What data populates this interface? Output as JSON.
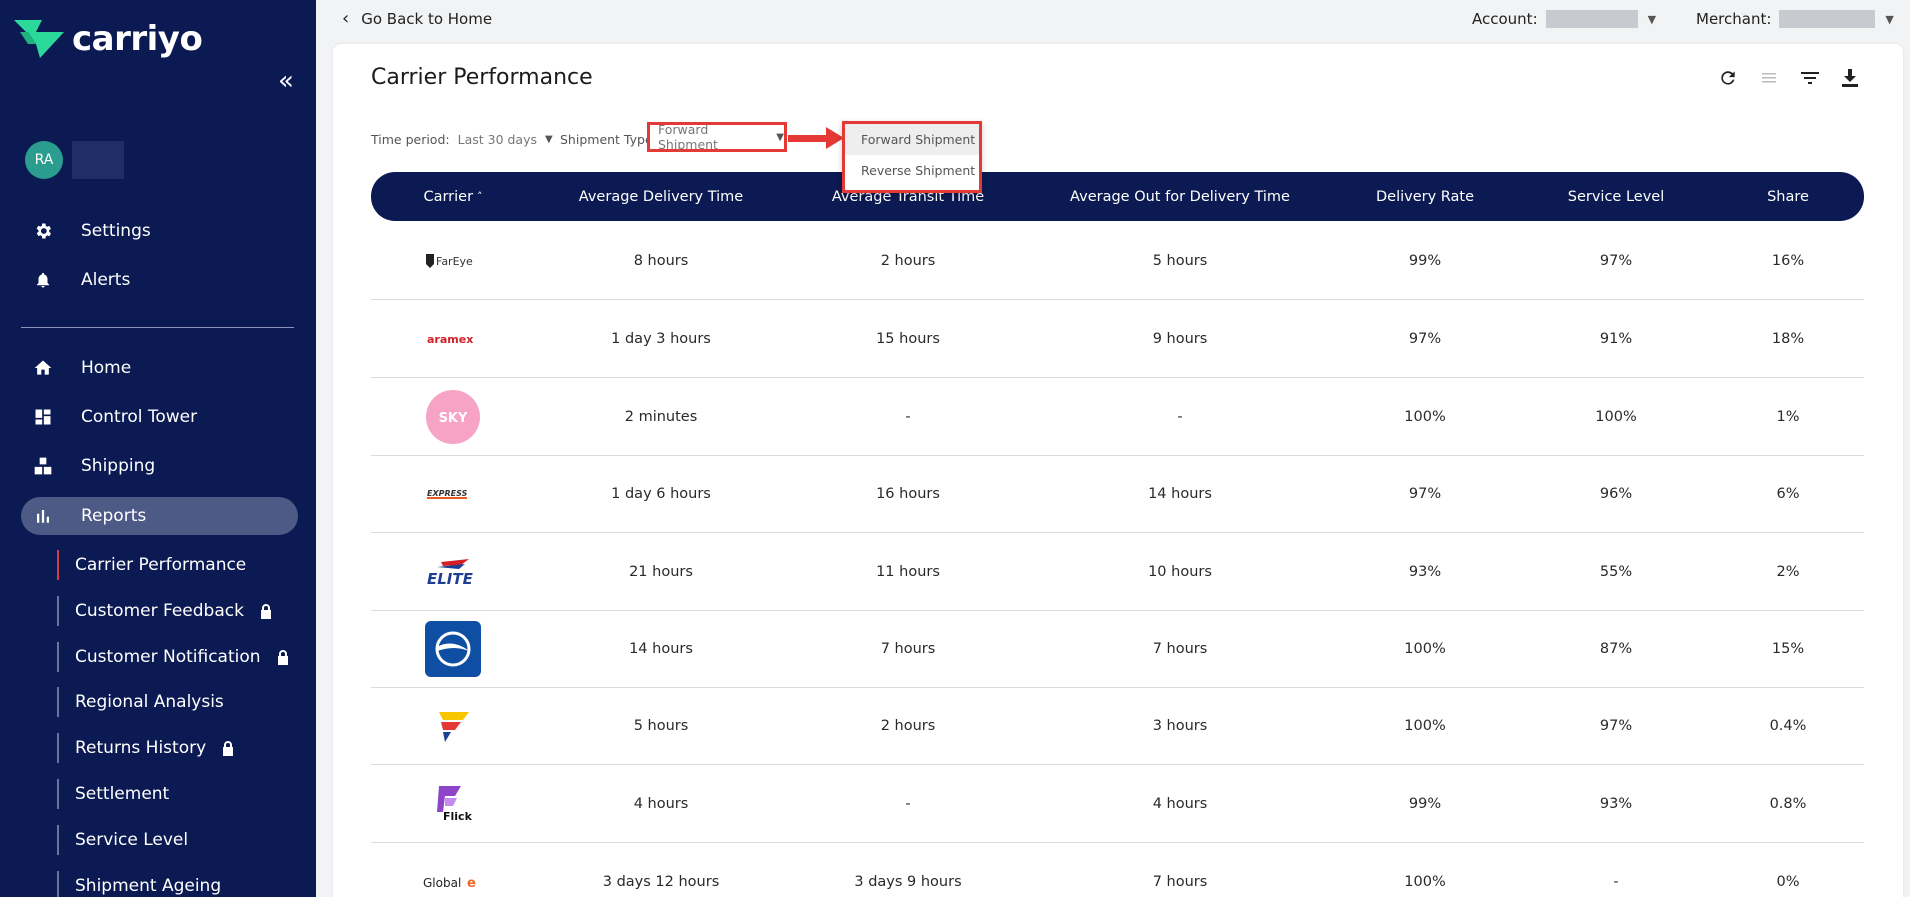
{
  "sidebar": {
    "brand": "carriyo",
    "avatar_initials": "RA",
    "items_top": [
      {
        "label": "Settings",
        "icon": "gear-icon"
      },
      {
        "label": "Alerts",
        "icon": "bell-icon"
      }
    ],
    "items_main": [
      {
        "label": "Home",
        "icon": "home-icon"
      },
      {
        "label": "Control Tower",
        "icon": "dashboard-icon"
      },
      {
        "label": "Shipping",
        "icon": "boxes-icon"
      },
      {
        "label": "Reports",
        "icon": "bar-chart-icon"
      }
    ],
    "report_items": [
      {
        "label": "Carrier Performance",
        "locked": false
      },
      {
        "label": "Customer Feedback",
        "locked": true
      },
      {
        "label": "Customer Notification",
        "locked": true
      },
      {
        "label": "Regional Analysis",
        "locked": false
      },
      {
        "label": "Returns History",
        "locked": true
      },
      {
        "label": "Settlement",
        "locked": false
      },
      {
        "label": "Service Level",
        "locked": false
      },
      {
        "label": "Shipment Ageing",
        "locked": false
      }
    ]
  },
  "topbar": {
    "back_label": "Go Back to Home",
    "account_label": "Account:",
    "merchant_label": "Merchant:"
  },
  "page": {
    "title": "Carrier Performance",
    "time_period_label": "Time period:",
    "time_period_value": "Last 30 days",
    "shipment_type_label": "Shipment Type",
    "shipment_type_value": "Forward Shipment",
    "shipment_type_options": [
      "Forward Shipment",
      "Reverse Shipment"
    ]
  },
  "table": {
    "headers": [
      "Carrier",
      "Average Delivery Time",
      "Average Transit Time",
      "Average Out for Delivery Time",
      "Delivery Rate",
      "Service Level",
      "Share"
    ],
    "sort_indicator": "˄",
    "rows": [
      {
        "carrier": "FarEye",
        "cells": [
          "8 hours",
          "2 hours",
          "5 hours",
          "99%",
          "97%",
          "16%"
        ]
      },
      {
        "carrier": "aramex",
        "cells": [
          "1 day 3 hours",
          "15 hours",
          "9 hours",
          "97%",
          "91%",
          "18%"
        ]
      },
      {
        "carrier": "SKY",
        "cells": [
          "2 minutes",
          "-",
          "-",
          "100%",
          "100%",
          "1%"
        ]
      },
      {
        "carrier": "EXPRESS",
        "cells": [
          "1 day 6 hours",
          "16 hours",
          "14 hours",
          "97%",
          "96%",
          "6%"
        ]
      },
      {
        "carrier": "ELITE",
        "cells": [
          "21 hours",
          "11 hours",
          "10 hours",
          "93%",
          "55%",
          "2%"
        ]
      },
      {
        "carrier": "blue-carrier",
        "cells": [
          "14 hours",
          "7 hours",
          "7 hours",
          "100%",
          "87%",
          "15%"
        ]
      },
      {
        "carrier": "flag-carrier",
        "cells": [
          "5 hours",
          "2 hours",
          "3 hours",
          "100%",
          "97%",
          "0.4%"
        ]
      },
      {
        "carrier": "Flick",
        "cells": [
          "4 hours",
          "-",
          "4 hours",
          "99%",
          "93%",
          "0.8%"
        ]
      },
      {
        "carrier": "Global-e",
        "cells": [
          "3 days 12 hours",
          "3 days 9 hours",
          "7 hours",
          "100%",
          "-",
          "0%"
        ]
      }
    ]
  },
  "colors": {
    "sidebar_bg": "#0b1a52",
    "table_header_bg": "#0b1a52",
    "brand_green": "#2bd99a",
    "highlight_red": "#e53935"
  }
}
